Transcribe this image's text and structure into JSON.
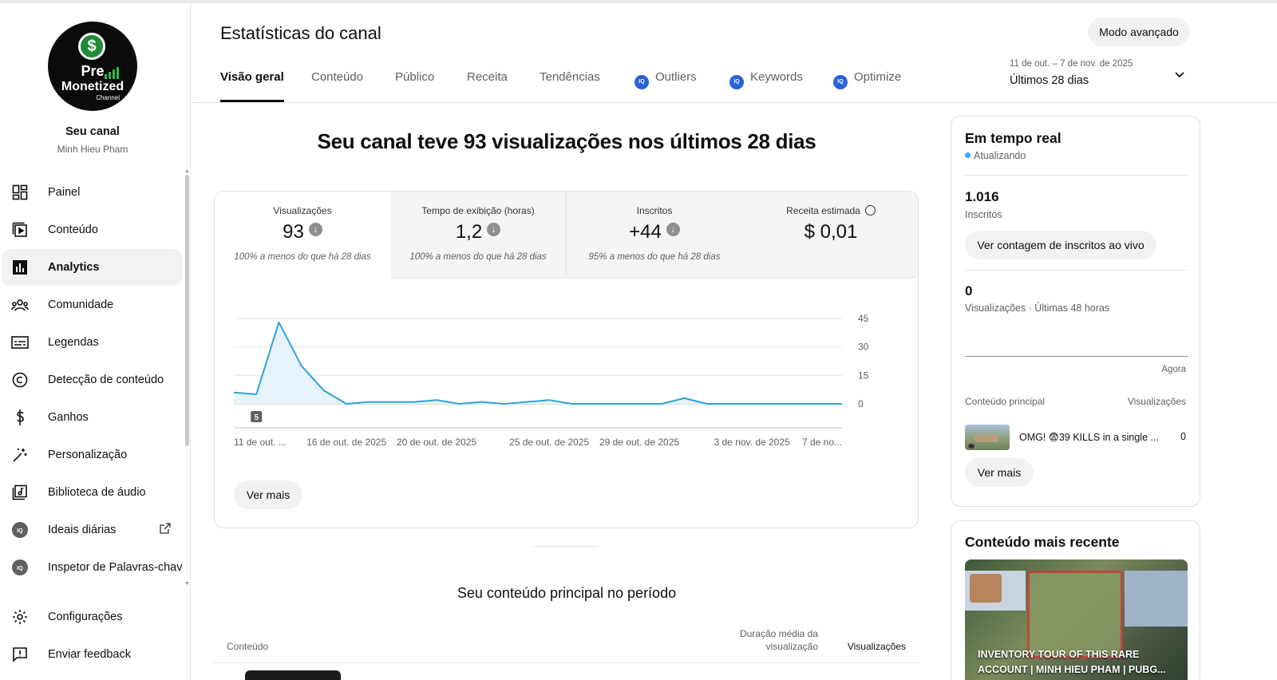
{
  "sidebar": {
    "channel_name": "Seu canal",
    "channel_owner": "Minh Hieu Pham",
    "logo": {
      "line1": "Pre",
      "line2": "Monetized",
      "line3": "Channel",
      "symbol": "$"
    },
    "items": [
      {
        "label": "Painel",
        "icon": "dashboard-icon"
      },
      {
        "label": "Conteúdo",
        "icon": "content-icon"
      },
      {
        "label": "Analytics",
        "icon": "analytics-icon",
        "active": true
      },
      {
        "label": "Comunidade",
        "icon": "community-icon"
      },
      {
        "label": "Legendas",
        "icon": "subtitles-icon"
      },
      {
        "label": "Detecção de conteúdo",
        "icon": "copyright-icon"
      },
      {
        "label": "Ganhos",
        "icon": "earn-icon"
      },
      {
        "label": "Personalização",
        "icon": "customization-icon"
      },
      {
        "label": "Biblioteca de áudio",
        "icon": "audio-library-icon"
      },
      {
        "label": "Ideais diárias",
        "icon": "vidiq-icon"
      },
      {
        "label": "Inspetor de Palavras-chav",
        "icon": "vidiq-icon"
      }
    ],
    "bottom_items": [
      {
        "label": "Configurações",
        "icon": "gear-icon"
      },
      {
        "label": "Enviar feedback",
        "icon": "feedback-icon"
      }
    ]
  },
  "header": {
    "title": "Estatísticas do canal",
    "advanced_mode": "Modo avançado",
    "tabs": [
      {
        "label": "Visão geral",
        "active": true
      },
      {
        "label": "Conteúdo"
      },
      {
        "label": "Público"
      },
      {
        "label": "Receita"
      },
      {
        "label": "Tendências"
      },
      {
        "label": "Outliers",
        "ext": true
      },
      {
        "label": "Keywords",
        "ext": true
      },
      {
        "label": "Optimize",
        "ext": true
      }
    ],
    "ext_badge": "IQ",
    "date_range": "11 de out. – 7 de nov. de 2025",
    "date_label": "Últimos 28 dias"
  },
  "main": {
    "headline": "Seu canal teve 93 visualizações nos últimos 28 dias",
    "metrics": [
      {
        "label": "Visualizações",
        "value": "93",
        "note": "100% a menos do que há 28 dias",
        "trend": "down"
      },
      {
        "label": "Tempo de exibição (horas)",
        "value": "1,2",
        "note": "100% a menos do que há 28 dias",
        "trend": "down"
      },
      {
        "label": "Inscritos",
        "value": "+44",
        "note": "95% a menos do que há 28 dias",
        "trend": "down"
      },
      {
        "label": "Receita estimada",
        "value": "$ 0,01",
        "note": "",
        "clock": true
      }
    ],
    "see_more": "Ver mais",
    "top_content_title": "Seu conteúdo principal no período",
    "table_headers": {
      "content": "Conteúdo",
      "avg_duration": "Duração média da visualização",
      "views": "Visualizações"
    }
  },
  "chart_data": {
    "type": "line",
    "x": [
      "11 de out.",
      "12 de out.",
      "13 de out.",
      "14 de out.",
      "15 de out.",
      "16 de out.",
      "17 de out.",
      "18 de out.",
      "19 de out.",
      "20 de out.",
      "21 de out.",
      "22 de out.",
      "23 de out.",
      "24 de out.",
      "25 de out.",
      "26 de out.",
      "27 de out.",
      "28 de out.",
      "29 de out.",
      "30 de out.",
      "31 de out.",
      "1 de nov.",
      "2 de nov.",
      "3 de nov.",
      "4 de nov.",
      "5 de nov.",
      "6 de nov.",
      "7 de nov."
    ],
    "series": [
      {
        "values": [
          6,
          5,
          43,
          20,
          7,
          0,
          1,
          1,
          1,
          2,
          0,
          1,
          0,
          1,
          2,
          0,
          0,
          0,
          0,
          0,
          3,
          0,
          0,
          0,
          0,
          0,
          0,
          0
        ]
      }
    ],
    "x_tick_labels": [
      "11 de out. ...",
      "16 de out. de 2025",
      "20 de out. de 2025",
      "25 de out. de 2025",
      "29 de out. de 2025",
      "3 de nov. de 2025",
      "7 de no..."
    ],
    "x_tick_index": [
      0,
      5,
      9,
      14,
      18,
      23,
      27
    ],
    "y_ticks": [
      0,
      15,
      30,
      45
    ],
    "ylim": [
      0,
      45
    ],
    "marker_label": "5",
    "color": "#2ea3d6",
    "fill": "#e6f3fa"
  },
  "realtime": {
    "title": "Em tempo real",
    "status": "Atualizando",
    "subscribers_value": "1.016",
    "subscribers_label": "Inscritos",
    "live_count_button": "Ver contagem de inscritos ao vivo",
    "views_value": "0",
    "views_label": "Visualizações · Últimas 48 horas",
    "now_label": "Agora",
    "top_content_label": "Conteúdo principal",
    "views_col_label": "Visualizações",
    "top_video_title": "OMG! 😨39 KILLS in a single ...",
    "top_video_views": "0",
    "see_more": "Ver mais"
  },
  "recent": {
    "title": "Conteúdo mais recente",
    "caption": "INVENTORY TOUR OF THIS RARE ACCOUNT | MINH HIEU PHAM | PUBG..."
  }
}
